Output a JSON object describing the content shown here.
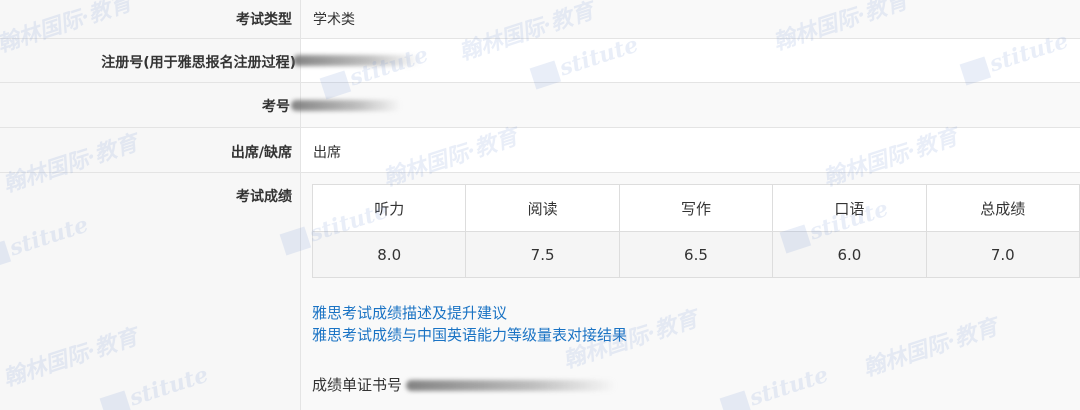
{
  "rows": [
    {
      "label": "考试类型",
      "value": "学术类"
    },
    {
      "label": "注册号(用于雅思报名注册过程)",
      "value": ""
    },
    {
      "label": "考号",
      "value": ""
    },
    {
      "label": "出席/缺席",
      "value": "出席"
    },
    {
      "label": "考试成绩",
      "value": ""
    }
  ],
  "scores": {
    "headers": [
      "听力",
      "阅读",
      "写作",
      "口语",
      "总成绩"
    ],
    "values": [
      "8.0",
      "7.5",
      "6.5",
      "6.0",
      "7.0"
    ]
  },
  "links": [
    "雅思考试成绩描述及提升建议",
    "雅思考试成绩与中国英语能力等级量表对接结果"
  ],
  "certificate_label": "成绩单证书号",
  "watermark": {
    "chinese": "翰林国际·教育",
    "english": "stitute"
  },
  "colors": {
    "link": "#1a73c4",
    "label_bg": "#f7f7f7",
    "border": "#e4e4e4"
  }
}
